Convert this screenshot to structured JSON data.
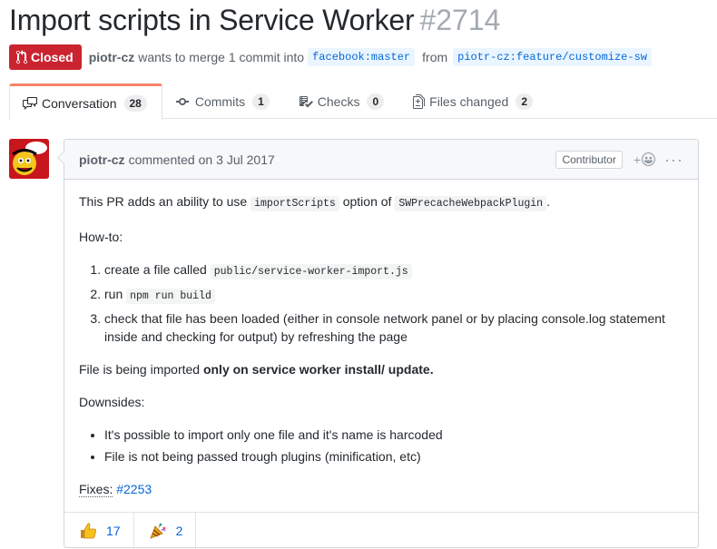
{
  "pr": {
    "title": "Import scripts in Service Worker",
    "number": "#2714",
    "state": "Closed",
    "author": "piotr-cz",
    "merge_text": "wants to merge 1 commit into",
    "base_branch": "facebook:master",
    "from_text": "from",
    "head_branch": "piotr-cz:feature/customize-sw"
  },
  "tabs": [
    {
      "label": "Conversation",
      "count": "28",
      "icon": "comment-discussion-icon"
    },
    {
      "label": "Commits",
      "count": "1",
      "icon": "git-commit-icon"
    },
    {
      "label": "Checks",
      "count": "0",
      "icon": "checklist-icon"
    },
    {
      "label": "Files changed",
      "count": "2",
      "icon": "file-diff-icon"
    }
  ],
  "comment": {
    "author": "piotr-cz",
    "action": "commented on",
    "date": "3 Jul 2017",
    "role": "Contributor",
    "intro_before": "This PR adds an ability to use",
    "intro_code1": "importScripts",
    "intro_mid": "option of",
    "intro_code2": "SWPrecacheWebpackPlugin",
    "intro_after": ".",
    "howto": "How-to:",
    "steps": [
      {
        "text": "create a file called",
        "code": "public/service-worker-import.js"
      },
      {
        "text": "run",
        "code": "npm run build"
      },
      {
        "text": "check that file has been loaded (either in console network panel or by placing console.log statement inside and checking for output) by refreshing the page",
        "code": ""
      }
    ],
    "imported_before": "File is being imported",
    "imported_bold": "only on service worker install/ update.",
    "downsides": "Downsides:",
    "downside_items": [
      "It's possible to import only one file and it's name is harcoded",
      "File is not being passed trough plugins (minification, etc)"
    ],
    "fixes_label": "Fixes:",
    "fixes_link": "#2253"
  },
  "reactions": [
    {
      "icon": "thumbs-up-icon",
      "count": "17"
    },
    {
      "icon": "tada-icon",
      "count": "2"
    }
  ],
  "colors": {
    "closed": "#cb2431",
    "link": "#0366d6",
    "tab_accent": "#f9826c"
  }
}
